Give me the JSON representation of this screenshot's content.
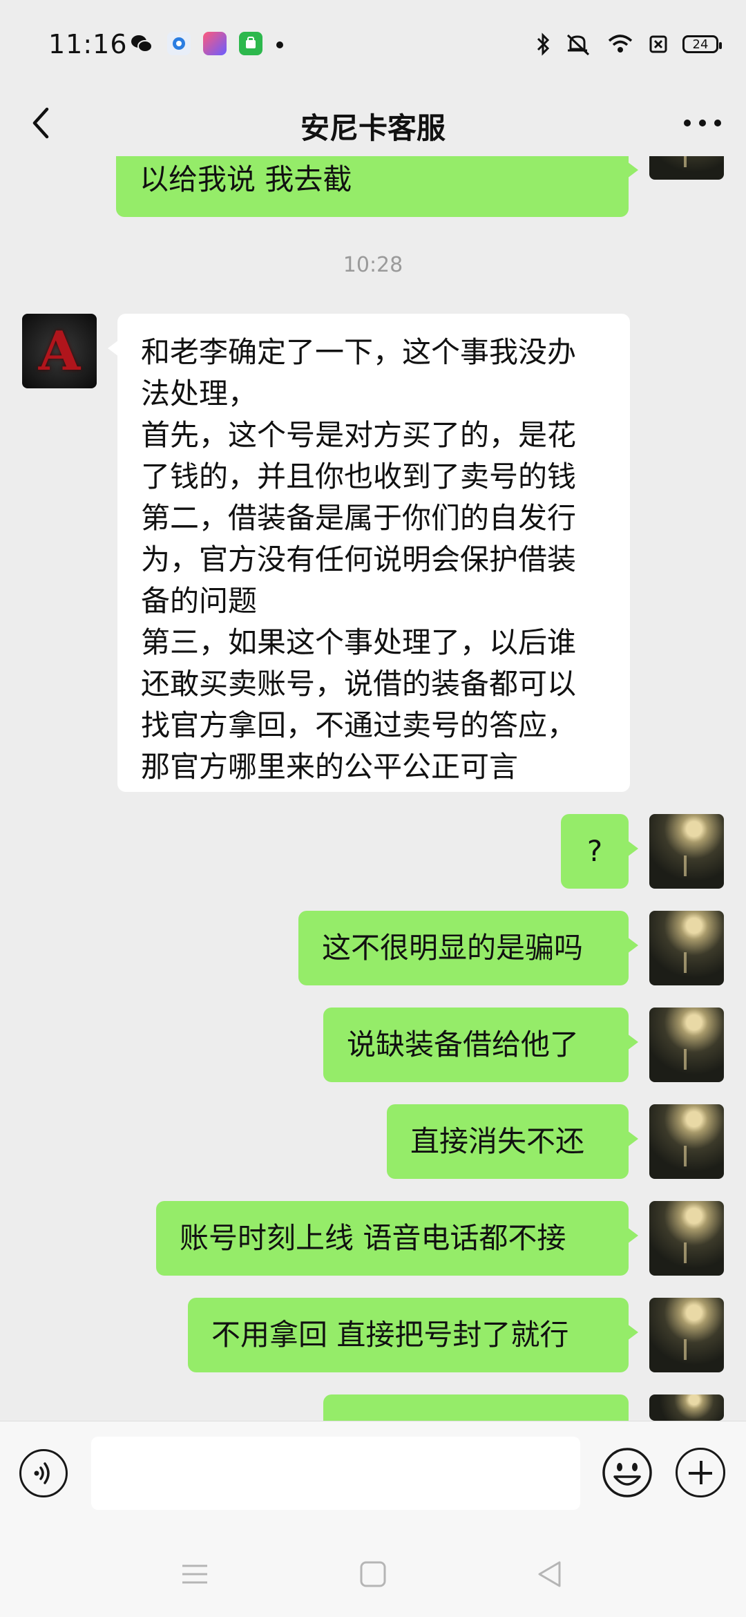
{
  "status_bar": {
    "time": "11:16",
    "battery": "24",
    "icons": [
      "wechat-icon",
      "app-icon",
      "app-icon",
      "app-icon",
      "bluetooth-icon",
      "mute-icon",
      "wifi-icon",
      "sim-icon",
      "battery-icon"
    ]
  },
  "header": {
    "title": "安尼卡客服"
  },
  "timestamp": "10:28",
  "messages": [
    {
      "from": "me",
      "lines": [
        "以给我说 我去截"
      ]
    },
    {
      "from": "them",
      "lines": [
        "和老李确定了一下，这个事我没办",
        "法处理，",
        "首先，这个号是对方买了的，是花",
        "了钱的，并且你也收到了卖号的钱",
        "第二，借装备是属于你们的自发行",
        "为，官方没有任何说明会保护借装",
        "备的问题",
        "第三，如果这个事处理了，以后谁",
        "还敢买卖账号，说借的装备都可以",
        "找官方拿回，不通过卖号的答应，",
        "那官方哪里来的公平公正可言"
      ]
    },
    {
      "from": "me",
      "lines": [
        "?"
      ]
    },
    {
      "from": "me",
      "lines": [
        "这不很明显的是骗吗"
      ]
    },
    {
      "from": "me",
      "lines": [
        "说缺装备借给他了"
      ]
    },
    {
      "from": "me",
      "lines": [
        "直接消失不还"
      ]
    },
    {
      "from": "me",
      "lines": [
        "账号时刻上线 语音电话都不接"
      ]
    },
    {
      "from": "me",
      "lines": [
        "不用拿回 直接把号封了就行"
      ]
    }
  ],
  "avatar_them_letter": "A",
  "input": {
    "value": "",
    "placeholder": ""
  },
  "colors": {
    "my_bubble": "#95ec69",
    "their_bubble": "#ffffff",
    "background": "#ededed"
  }
}
